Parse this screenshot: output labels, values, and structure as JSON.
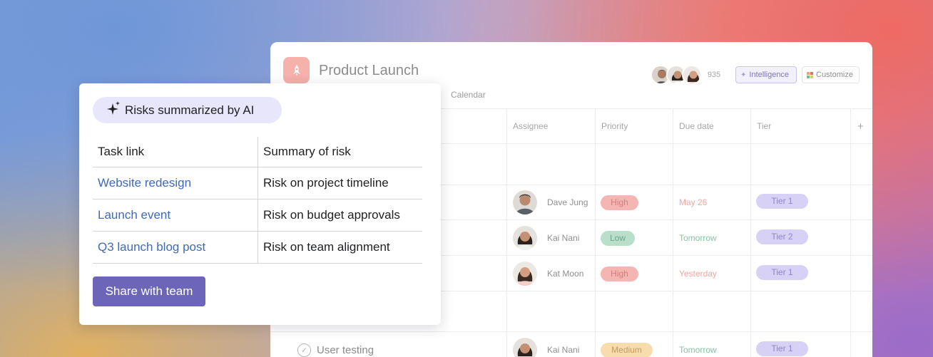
{
  "project": {
    "title": "Product Launch",
    "member_count": "935",
    "intelligence_label": "Intelligence",
    "customize_label": "Customize",
    "calendar_tab": "Calendar",
    "columns": [
      "Assignee",
      "Priority",
      "Due date",
      "Tier",
      "+"
    ],
    "rows": [
      {
        "assignee": "Dave Jung",
        "priority": "High",
        "due": "May 26",
        "tier": "Tier 1"
      },
      {
        "assignee": "Kai Nani",
        "priority": "Low",
        "due": "Tomorrow",
        "tier": "Tier 2"
      },
      {
        "assignee": "Kat Moon",
        "priority": "High",
        "due": "Yesterday",
        "tier": "Tier 1"
      },
      {
        "task": "User testing",
        "assignee": "Kai Nani",
        "priority": "Medium",
        "due": "Tomorrow",
        "tier": "Tier 1"
      }
    ]
  },
  "ai_card": {
    "badge": "Risks summarized by AI",
    "headers": {
      "task": "Task link",
      "summary": "Summary of risk"
    },
    "rows": [
      {
        "task": "Website redesign",
        "summary": "Risk on project timeline"
      },
      {
        "task": "Launch event",
        "summary": "Risk on budget approvals"
      },
      {
        "task": "Q3 launch blog post",
        "summary": "Risk on team alignment"
      }
    ],
    "share_label": "Share with team"
  },
  "colors": {
    "accent": "#6d66b8",
    "link": "#3f6ab8",
    "badge_bg": "#e8e6fb"
  }
}
